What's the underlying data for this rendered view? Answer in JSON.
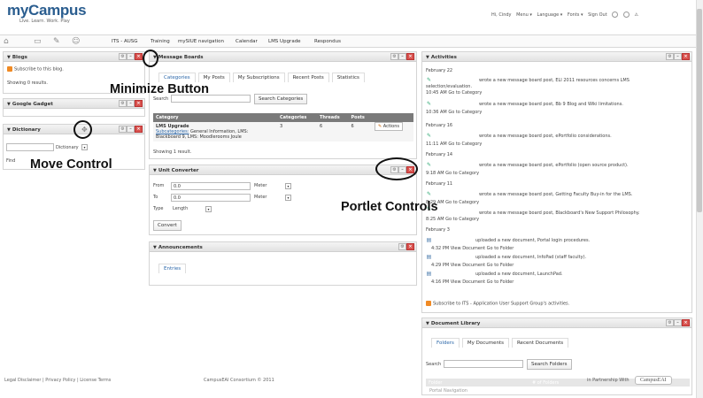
{
  "header": {
    "logo": "myCampus",
    "tagline": "Live. Learn. Work. Play",
    "user_links": [
      "Hi, Cindy",
      "Menu ▾",
      "Language ▾",
      "Fonts ▾",
      "Sign Out"
    ]
  },
  "nav": {
    "items": [
      "ITS - AUSG",
      "Training",
      "mySIUE navigation",
      "Calendar",
      "LMS Upgrade",
      "Respondus"
    ]
  },
  "blogs": {
    "title": "Blogs",
    "subscribe": "Subscribe to this blog.",
    "results": "Showing 0 results."
  },
  "google_gadget": {
    "title": "Google Gadget"
  },
  "dictionary": {
    "title": "Dictionary",
    "select_value": "Dictionary",
    "find": "Find"
  },
  "message_boards": {
    "title": "Message Boards",
    "tabs": [
      "Categories",
      "My Posts",
      "My Subscriptions",
      "Recent Posts",
      "Statistics"
    ],
    "search_label": "Search",
    "search_button": "Search Categories",
    "columns": [
      "Category",
      "Categories",
      "Threads",
      "Posts"
    ],
    "row": {
      "name": "LMS Upgrade",
      "sub_label": "Subcategories:",
      "sub_text": "General Information, LMS:",
      "sub_text2": "Blackboard 9, LMS: Moodlerooms Joule",
      "categories": "3",
      "threads": "6",
      "posts": "6",
      "action": "Actions"
    },
    "showing": "Showing 1 result."
  },
  "unit_converter": {
    "title": "Unit Converter",
    "from_label": "From",
    "from_value": "0.0",
    "from_unit": "Meter",
    "to_label": "To",
    "to_value": "0.0",
    "to_unit": "Meter",
    "type_label": "Type",
    "type_value": "Length",
    "convert": "Convert"
  },
  "announcements": {
    "title": "Announcements",
    "tab": "Entries"
  },
  "activities": {
    "title": "Activities",
    "groups": [
      {
        "date": "February 22",
        "entries": [
          {
            "text": "wrote a new message board post, ELI 2011 resources concerns LMS",
            "text2": "selection/evaluation.",
            "time": "10:45 AM Go to Category"
          },
          {
            "text": "wrote a new message board post, Bb 9 Blog and Wiki limitations.",
            "time": "10:36 AM Go to Category"
          }
        ]
      },
      {
        "date": "February 16",
        "entries": [
          {
            "text": "wrote a new message board post, ePortfolio considerations.",
            "time": "11:11 AM Go to Category"
          }
        ]
      },
      {
        "date": "February 14",
        "entries": [
          {
            "text": "wrote a new message board post, ePortfolio (open source product).",
            "time": "9:18 AM Go to Category"
          }
        ]
      },
      {
        "date": "February 11",
        "entries": [
          {
            "text": "wrote a new message board post, Getting Faculty Buy-in for the LMS.",
            "time": "8:29 AM Go to Category"
          },
          {
            "text": "wrote a new message board post, Blackboard's New Support Philosophy.",
            "time": "8:25 AM Go to Category"
          }
        ]
      },
      {
        "date": "February 3",
        "entries": [
          {
            "text": "uploaded a new document, Portal login procedures.",
            "time": "4:32 PM View Document Go to Folder"
          },
          {
            "text": "uploaded a new document, InfoPad (staff faculty).",
            "time": "4:29 PM View Document Go to Folder"
          },
          {
            "text": "uploaded a new document, LaunchPad.",
            "time": "4:16 PM View Document Go to Folder"
          }
        ]
      }
    ],
    "subscribe": "Subscribe to ITS - Application User Support Group's activities."
  },
  "document_library": {
    "title": "Document Library",
    "tabs": [
      "Folders",
      "My Documents",
      "Recent Documents"
    ],
    "search_label": "Search",
    "search_button": "Search Folders",
    "table_header": [
      "Folder",
      "# of Folders"
    ],
    "row": "Portal Navigation",
    "partner": "in Partnership With",
    "partner_logo": "CampusEAI"
  },
  "footer": {
    "left": "Legal Disclaimer | Privacy Policy | License Terms",
    "center": "CampusEAI Consortium © 2011"
  },
  "annotations": {
    "minimize": "Minimize Button",
    "move": "Move Control",
    "portlet": "Portlet Controls"
  },
  "colors": {
    "accent": "#2a66a8",
    "close": "#d9534f",
    "rss": "#f08a24"
  }
}
